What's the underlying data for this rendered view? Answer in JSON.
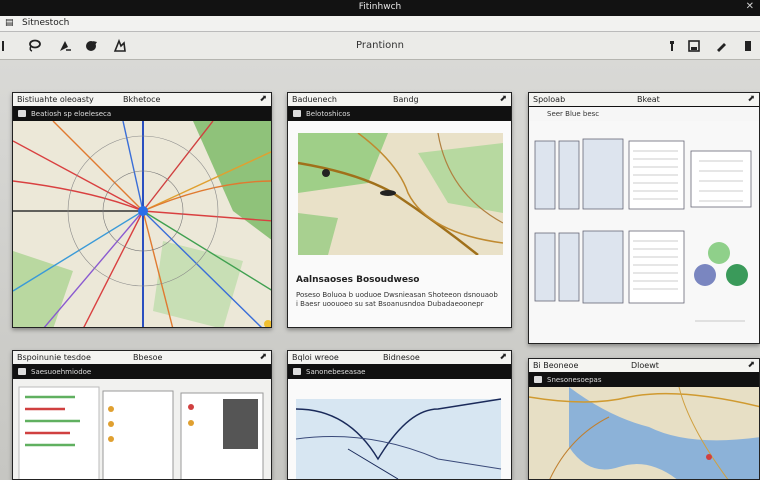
{
  "window": {
    "title": "Fitinhwch",
    "close_glyph": "✕"
  },
  "menubar": {
    "icon_glyph": "▤",
    "title": "Sitnestoch"
  },
  "toolbar": {
    "title": "Prantionn"
  },
  "cards": [
    {
      "head_left": "Bistiuahte oleoasty",
      "head_center": "Bkhetoce",
      "sub": "Beatiosh sp eloeleseca"
    },
    {
      "head_left": "Baduenech",
      "head_center": "Bandg",
      "sub": "Belotoshicos",
      "text_title": "Aalnsaoses Bosoudweso",
      "text_lines": [
        "Poseso Boluoa b uoduoe Dwsnieasan Shoteeon dsnouaob",
        "i Baesr uoouoeo su sat Bsoanusndoa Dubadaeoonepr"
      ]
    },
    {
      "head_left": "Spoloab",
      "head_center": "Bkeat",
      "sub": "Seer Blue besc"
    },
    {
      "head_left": "Bspoinunie tesdoe",
      "head_center": "Bbesoe",
      "sub": "Saesuoehmiodoe"
    },
    {
      "head_left": "Bqloi wreoe",
      "head_center": "Bidnesoe",
      "sub": "Sanonebeseasae"
    },
    {
      "head_left": "Bi Beoneoe",
      "head_center": "Dloewt",
      "sub": "Snesonesoepas"
    }
  ]
}
